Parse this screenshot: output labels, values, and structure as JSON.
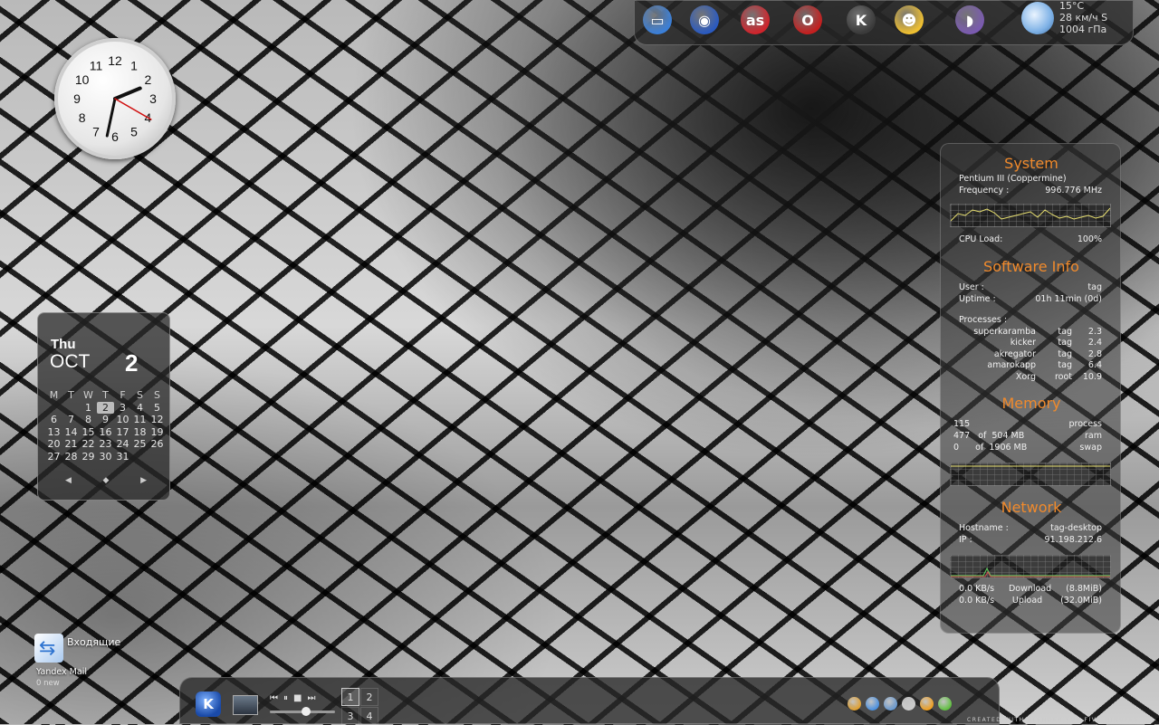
{
  "top_launcher": {
    "apps": [
      {
        "name": "monitor-icon",
        "color": "#3a7fd8",
        "glyph": "▭"
      },
      {
        "name": "firefox-icon",
        "color": "#2a5ac0",
        "glyph": "◉"
      },
      {
        "name": "lastfm-icon",
        "color": "#d0242c",
        "glyph": "as"
      },
      {
        "name": "opera-icon",
        "color": "#c41f1f",
        "glyph": "O"
      },
      {
        "name": "kde-icon",
        "color": "#3a3a3a",
        "glyph": "K"
      },
      {
        "name": "tux-icon",
        "color": "#f0c030",
        "glyph": "☻"
      },
      {
        "name": "pidgin-icon",
        "color": "#7a5ab0",
        "glyph": "◗"
      }
    ]
  },
  "weather": {
    "temp": "15°C",
    "wind": "28 км/ч S",
    "pressure": "1004 гПа"
  },
  "clock": {
    "numerals": [
      "12",
      "1",
      "2",
      "3",
      "4",
      "5",
      "6",
      "7",
      "8",
      "9",
      "10",
      "11"
    ],
    "hour": 2.25,
    "minute": 32,
    "second": 20
  },
  "calendar": {
    "weekday": "Thu",
    "month": "OCT",
    "day": "2",
    "headers": [
      "M",
      "T",
      "W",
      "T",
      "F",
      "S",
      "S"
    ],
    "weeks": [
      [
        "",
        "",
        "1",
        "2",
        "3",
        "4",
        "5"
      ],
      [
        "6",
        "7",
        "8",
        "9",
        "10",
        "11",
        "12"
      ],
      [
        "13",
        "14",
        "15",
        "16",
        "17",
        "18",
        "19"
      ],
      [
        "20",
        "21",
        "22",
        "23",
        "24",
        "25",
        "26"
      ],
      [
        "27",
        "28",
        "29",
        "30",
        "31",
        "",
        ""
      ]
    ],
    "today": "2",
    "nav": {
      "prev": "◀",
      "home": "◆",
      "next": "▶"
    }
  },
  "system": {
    "title": "System",
    "cpu": "Pentium III (Coppermine)",
    "freq_label": "Frequency :",
    "freq_value": "996.776  MHz",
    "load_label": "CPU Load:",
    "load_value": "100%"
  },
  "software": {
    "title": "Software Info",
    "user_label": "User :",
    "user_value": "tag",
    "uptime_label": "Uptime :",
    "uptime_value": "01h 11min (0d)",
    "processes_label": "Processes :",
    "processes": [
      {
        "name": "superkaramba",
        "user": "tag",
        "cpu": "2.3"
      },
      {
        "name": "kicker",
        "user": "tag",
        "cpu": "2.4"
      },
      {
        "name": "akregator",
        "user": "tag",
        "cpu": "2.8"
      },
      {
        "name": "amarokapp",
        "user": "tag",
        "cpu": "6.4"
      },
      {
        "name": "Xorg",
        "user": "root",
        "cpu": "10.9"
      }
    ]
  },
  "memory": {
    "title": "Memory",
    "process_count": "115",
    "process_label": "process",
    "ram": "477   of  504 MB",
    "ram_label": "ram",
    "swap": "0      of  1906 MB",
    "swap_label": "swap"
  },
  "network": {
    "title": "Network",
    "host_label": "Hostname :",
    "host_value": "tag-desktop",
    "ip_label": "IP :",
    "ip_value": "91.198.212.6",
    "down_rate": "0.0 KB/s",
    "down_label": "Download",
    "down_total": "(8.8MiB)",
    "up_rate": "0.0 KB/s",
    "up_label": "Upload",
    "up_total": "(32.0MiB)"
  },
  "taskbar": {
    "kmenu": "K",
    "media": {
      "prev": "⏮",
      "pause": "⏸",
      "stop": "■",
      "next": "⏭"
    },
    "pager": [
      "1",
      "2",
      "3",
      "4"
    ],
    "active_desktop": "1",
    "tray_colors": [
      "#e0a030",
      "#4a90e0",
      "#6a9ad0",
      "#cccccc",
      "#f0a020",
      "#60c040"
    ]
  },
  "desktop_icon": {
    "title": "Входящие",
    "label": "Yandex Mail",
    "sub": "0 new"
  },
  "credit": "CREATED WITH BLENDER FOR FIVE MINUTES"
}
